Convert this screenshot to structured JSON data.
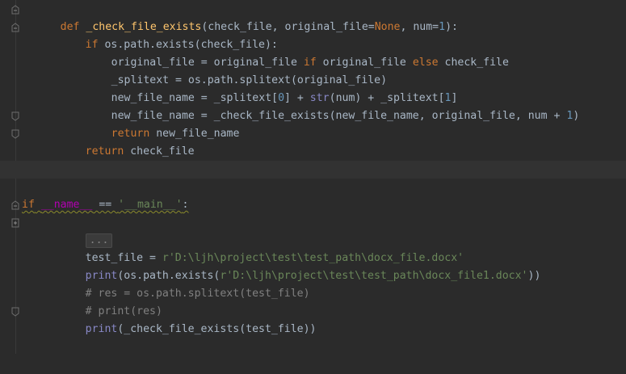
{
  "editor": {
    "lines": {
      "l1": {
        "kw_def": "def",
        "fn": "_check_file_exists",
        "p1": "(check_file, original_file=",
        "none": "None",
        "p2": ", num=",
        "n1": "1",
        "p3": "):"
      },
      "l2": {
        "kw_if": "if",
        "rest": " os.path.exists(check_file):"
      },
      "l3": {
        "a": "original_file = original_file ",
        "kw_if": "if",
        "b": " original_file ",
        "kw_else": "else",
        "c": " check_file"
      },
      "l4": {
        "text": "_splitext = os.path.splitext(original_file)"
      },
      "l5": {
        "a": "new_file_name = _splitext[",
        "n0": "0",
        "b": "] + ",
        "str": "str",
        "c": "(num) + _splitext[",
        "n1": "1",
        "d": "]"
      },
      "l6": {
        "a": "new_file_name = _check_file_exists(new_file_name, original_file, num + ",
        "n1": "1",
        "b": ")"
      },
      "l7": {
        "kw": "return",
        "rest": " new_file_name"
      },
      "l8": {
        "kw": "return",
        "rest": " check_file"
      },
      "l11": {
        "kw_if": "if",
        "sp": " ",
        "name": "__name__",
        "eq": " == ",
        "str": "'__main__'",
        "colon": ":"
      },
      "l12": {
        "folded": "..."
      },
      "l13": {
        "a": "test_file = ",
        "str": "r'D:\\ljh\\project\\test\\test_path\\docx_file.docx'"
      },
      "l14": {
        "print": "print",
        "a": "(os.path.exists(",
        "str": "r'D:\\ljh\\project\\test\\test_path\\docx_file1.docx'",
        "b": "))"
      },
      "l15": {
        "text": "# res = os.path.splitext(test_file)"
      },
      "l16": {
        "text": "# print(res)"
      },
      "l17": {
        "print": "print",
        "a": "(_check_file_exists(test_file))"
      }
    }
  },
  "colors": {
    "background": "#2b2b2b",
    "keyword": "#cc7832",
    "function": "#ffc66d",
    "number": "#6897bb",
    "string": "#6a8759",
    "comment": "#808080",
    "text": "#a9b7c6",
    "current_line": "#323232"
  }
}
